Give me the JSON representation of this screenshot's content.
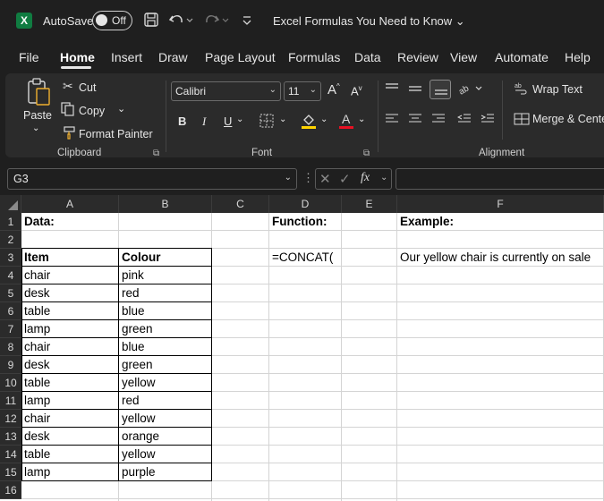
{
  "titlebar": {
    "logo": "X",
    "autosave_label": "AutoSave",
    "autosave_state": "Off",
    "doc_title": "Excel Formulas You Need to Know ⌄"
  },
  "menu": [
    "File",
    "Home",
    "Insert",
    "Draw",
    "Page Layout",
    "Formulas",
    "Data",
    "Review",
    "View",
    "Automate",
    "Help"
  ],
  "ribbon": {
    "clipboard": {
      "paste": "Paste",
      "cut": "Cut",
      "copy": "Copy",
      "format_painter": "Format Painter",
      "label": "Clipboard"
    },
    "font": {
      "font_name": "Calibri",
      "font_size": "11",
      "label": "Font"
    },
    "alignment": {
      "wrap_text": "Wrap Text",
      "merge_center": "Merge & Cente",
      "label": "Alignment"
    }
  },
  "formula_bar": {
    "name_box": "G3",
    "fx": "fx",
    "content": ""
  },
  "columns": [
    "A",
    "B",
    "C",
    "D",
    "E",
    "F"
  ],
  "rows": [
    "1",
    "2",
    "3",
    "4",
    "5",
    "6",
    "7",
    "8",
    "9",
    "10",
    "11",
    "12",
    "13",
    "14",
    "15",
    "16"
  ],
  "sheet": {
    "data_label": "Data:",
    "function_label": "Function:",
    "example_label": "Example:",
    "function_value": "=CONCAT(",
    "example_value": "Our yellow chair is currently on sale",
    "header_item": "Item",
    "header_colour": "Colour",
    "table": [
      {
        "item": "chair",
        "colour": "pink"
      },
      {
        "item": "desk",
        "colour": "red"
      },
      {
        "item": "table",
        "colour": "blue"
      },
      {
        "item": "lamp",
        "colour": "green"
      },
      {
        "item": "chair",
        "colour": "blue"
      },
      {
        "item": "desk",
        "colour": "green"
      },
      {
        "item": "table",
        "colour": "yellow"
      },
      {
        "item": "lamp",
        "colour": "red"
      },
      {
        "item": "chair",
        "colour": "yellow"
      },
      {
        "item": "desk",
        "colour": "orange"
      },
      {
        "item": "table",
        "colour": "yellow"
      },
      {
        "item": "lamp",
        "colour": "purple"
      }
    ]
  },
  "colors": {
    "accent_green": "#107c41",
    "highlight_yellow": "#ffd400",
    "font_red": "#e81123"
  }
}
